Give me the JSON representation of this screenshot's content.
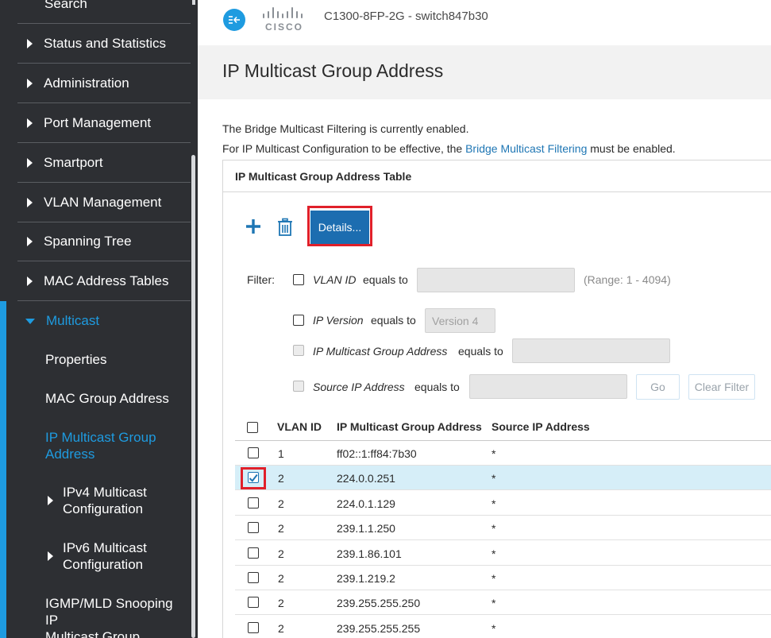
{
  "sidebar": {
    "top_item": "Search",
    "items": [
      {
        "label": "Status and Statistics"
      },
      {
        "label": "Administration"
      },
      {
        "label": "Port Management"
      },
      {
        "label": "Smartport"
      },
      {
        "label": "VLAN Management"
      },
      {
        "label": "Spanning Tree"
      },
      {
        "label": "MAC Address Tables"
      }
    ],
    "active_section": "Multicast",
    "sub_items": {
      "properties": "Properties",
      "mac_group": "MAC Group Address",
      "ip_group_line1": "IP Multicast Group",
      "ip_group_line2": "Address",
      "ipv4_line1": "IPv4 Multicast",
      "ipv4_line2": "Configuration",
      "ipv6_line1": "IPv6 Multicast",
      "ipv6_line2": "Configuration",
      "igmp_line1": "IGMP/MLD Snooping IP",
      "igmp_line2": "Multicast Group"
    }
  },
  "header": {
    "logo_word": "CISCO",
    "device_name": "C1300-8FP-2G - switch847b30"
  },
  "page": {
    "title": "IP Multicast Group Address",
    "status_msg": "The Bridge Multicast Filtering is currently enabled.",
    "config_msg_prefix": "For IP Multicast Configuration to be effective, the ",
    "config_msg_link": "Bridge Multicast Filtering",
    "config_msg_suffix": " must be enabled."
  },
  "table_panel": {
    "title": "IP Multicast Group Address Table",
    "details_button": "Details...",
    "filter": {
      "label": "Filter:",
      "vlan_label": "VLAN ID",
      "vlan_op": "equals to",
      "vlan_value": "",
      "vlan_range": "(Range: 1 - 4094)",
      "ipver_label": "IP Version",
      "ipver_op": "equals to",
      "ipver_placeholder": "Version 4",
      "group_label": "IP Multicast Group Address",
      "group_op": "equals to",
      "group_value": "",
      "source_label": "Source IP Address",
      "source_op": "equals to",
      "source_value": "",
      "go_button": "Go",
      "clear_button": "Clear Filter"
    },
    "columns": [
      "VLAN ID",
      "IP Multicast Group Address",
      "Source IP Address"
    ],
    "rows": [
      {
        "vlan": "1",
        "group": "ff02::1:ff84:7b30",
        "source": "*",
        "checked": false
      },
      {
        "vlan": "2",
        "group": "224.0.0.251",
        "source": "*",
        "checked": true
      },
      {
        "vlan": "2",
        "group": "224.0.1.129",
        "source": "*",
        "checked": false
      },
      {
        "vlan": "2",
        "group": "239.1.1.250",
        "source": "*",
        "checked": false
      },
      {
        "vlan": "2",
        "group": "239.1.86.101",
        "source": "*",
        "checked": false
      },
      {
        "vlan": "2",
        "group": "239.1.219.2",
        "source": "*",
        "checked": false
      },
      {
        "vlan": "2",
        "group": "239.255.255.250",
        "source": "*",
        "checked": false
      },
      {
        "vlan": "2",
        "group": "239.255.255.255",
        "source": "*",
        "checked": false
      }
    ]
  },
  "colors": {
    "accent": "#1e9be0",
    "sidebar_bg": "#2d2f33",
    "button_blue": "#1c6db0",
    "selected_row": "#d6eef8",
    "highlight_red": "#e0202a"
  }
}
